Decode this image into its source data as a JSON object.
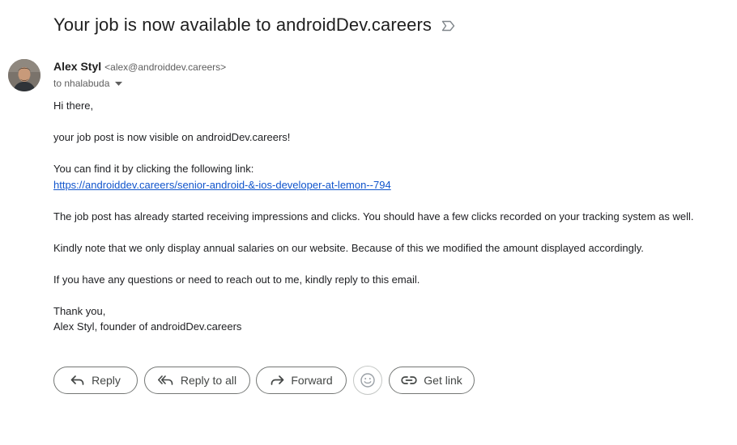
{
  "email": {
    "subject": "Your job is now available to androidDev.careers",
    "sender": {
      "name": "Alex Styl",
      "email": "<alex@androiddev.careers>"
    },
    "recipient": "to nhalabuda",
    "body": {
      "greeting": "Hi there,",
      "p1": "your job post is now visible on androidDev.careers!",
      "p2": "You can find it by clicking the following link:",
      "link": "https://androiddev.careers/senior-android-&-ios-developer-at-lemon--794",
      "p3": "The job post has already started receiving impressions and clicks. You should have a few clicks recorded on your tracking system as well.",
      "p4": "Kindly note that we only display annual salaries on our website. Because of this we modified the amount displayed accordingly.",
      "p5": "If you have any questions or need to reach out to me, kindly reply to this email.",
      "closing": "Thank you,",
      "signature": "Alex Styl, founder of androidDev.careers"
    }
  },
  "actions": {
    "reply": "Reply",
    "reply_all": "Reply to all",
    "forward": "Forward",
    "get_link": "Get link"
  },
  "icons": {
    "label": "label-outline-icon",
    "caret": "caret-down-icon",
    "reply": "reply-arrow-icon",
    "reply_all": "reply-all-icon",
    "forward": "forward-arrow-icon",
    "emoji": "emoji-smile-icon",
    "link": "link-icon"
  }
}
